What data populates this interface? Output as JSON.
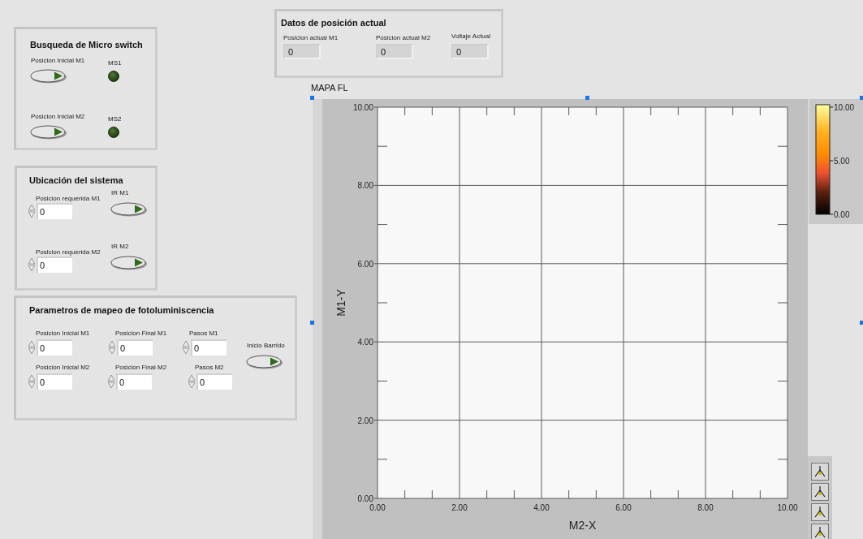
{
  "micro_switch_search": {
    "title": "Busqueda de Micro switch",
    "rows": [
      {
        "button_label": "Posicion Inicial M1",
        "led_label": "MS1",
        "led_on": false
      },
      {
        "button_label": "Posicion Inicial M2",
        "led_label": "MS2",
        "led_on": false
      }
    ]
  },
  "system_location": {
    "title": "Ubicación del sistema",
    "rows": [
      {
        "field_label": "Posicion requerida M1",
        "value": "0",
        "button_label": "IR M1"
      },
      {
        "field_label": "Posicion requerida M2",
        "value": "0",
        "button_label": "IR M2"
      }
    ]
  },
  "pl_mapping": {
    "title": "Parametros de mapeo de fotoluminiscencia",
    "fields": [
      {
        "label": "Posicion Inicial M1",
        "value": "0"
      },
      {
        "label": "Posicion Final M1",
        "value": "0"
      },
      {
        "label": "Pasos M1",
        "value": "0"
      },
      {
        "label": "Posicion Inicial M2",
        "value": "0"
      },
      {
        "label": "Posicion Final M2",
        "value": "0"
      },
      {
        "label": "Pasos M2",
        "value": "0"
      }
    ],
    "button_label": "Inicio Barrido"
  },
  "current_position": {
    "title": "Datos de posición actual",
    "indicators": [
      {
        "label": "Posicion actual M1",
        "value": "0"
      },
      {
        "label": "Posicion actual M2",
        "value": "0"
      },
      {
        "label": "Voltaje Actual",
        "value": "0"
      }
    ]
  },
  "graph": {
    "chart_data": {
      "type": "scatter",
      "title": "MAPA FL",
      "grid": true,
      "xlabel": "M2-X",
      "ylabel": "M1-Y",
      "xlim": [
        0,
        10
      ],
      "ylim": [
        0,
        10
      ],
      "xticks": [
        {
          "value": 0,
          "label": "0.00"
        },
        {
          "value": 2,
          "label": "2.00"
        },
        {
          "value": 4,
          "label": "4.00"
        },
        {
          "value": 6,
          "label": "6.00"
        },
        {
          "value": 8,
          "label": "8.00"
        },
        {
          "value": 10,
          "label": "10.00"
        }
      ],
      "yticks": [
        {
          "value": 0,
          "label": "0.00"
        },
        {
          "value": 2,
          "label": "2.00"
        },
        {
          "value": 4,
          "label": "4.00"
        },
        {
          "value": 6,
          "label": "6.00"
        },
        {
          "value": 8,
          "label": "8.00"
        },
        {
          "value": 10,
          "label": "10.00"
        }
      ]
    },
    "color_scale": {
      "ticks": [
        "10.00",
        "5.00",
        "0.00"
      ]
    }
  }
}
